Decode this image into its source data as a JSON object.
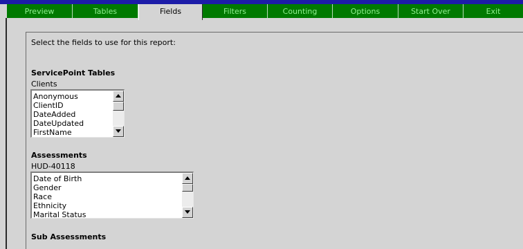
{
  "tabs": [
    {
      "label": "Preview",
      "active": false
    },
    {
      "label": "Tables",
      "active": false
    },
    {
      "label": "Fields",
      "active": true
    },
    {
      "label": "Filters",
      "active": false
    },
    {
      "label": "Counting",
      "active": false
    },
    {
      "label": "Options",
      "active": false
    },
    {
      "label": "Start Over",
      "active": false
    },
    {
      "label": "Exit",
      "active": false
    }
  ],
  "instructions": "Select the fields to use for this report:",
  "servicepoint": {
    "heading": "ServicePoint Tables",
    "label": "Clients",
    "options": [
      "Anonymous",
      "ClientID",
      "DateAdded",
      "DateUpdated",
      "FirstName"
    ]
  },
  "assessments": {
    "heading": "Assessments",
    "label": "HUD-40118",
    "options": [
      "Date of Birth",
      "Gender",
      "Race",
      "Ethnicity",
      "Marital Status"
    ]
  },
  "sub_assessments": {
    "heading": "Sub Assessments"
  },
  "colors": {
    "tab_bar": "#007a00",
    "tab_text": "#8ff08f",
    "top_strip": "#1c1ca8",
    "background": "#d4d4d4"
  },
  "icons": {
    "scroll_up": "triangle-up",
    "scroll_down": "triangle-down"
  }
}
